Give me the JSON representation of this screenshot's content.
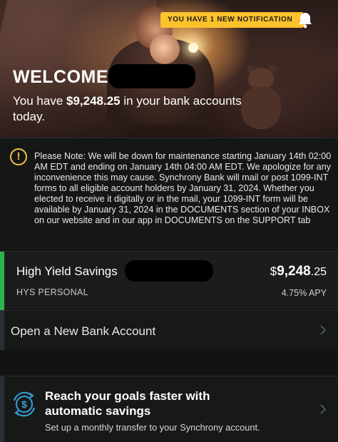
{
  "hero": {
    "notification_label": "YOU HAVE 1 NEW NOTIFICATION",
    "welcome": "WELCOME",
    "balance_prefix": "You have ",
    "balance_amount": "$9,248.25",
    "balance_suffix": " in your bank accounts today."
  },
  "notice": {
    "icon": "warning-icon",
    "text": "Please Note: We will be down for maintenance starting January 14th 02:00 AM EDT and ending on January 14th 04:00 AM EDT. We apologize for any inconvenience this may cause.  Synchrony Bank will mail or post 1099-INT forms to all eligible account holders by January 31, 2024. Whether you elected to receive it digitally or in the mail, your 1099-INT form will be available by January 31, 2024 in the DOCUMENTS section of your INBOX on our website and in our app in DOCUMENTS on the SUPPORT tab"
  },
  "account": {
    "name": "High Yield Savings",
    "type": "HYS PERSONAL",
    "balance_symbol": "$",
    "balance_whole": "9,248",
    "balance_cents": ".25",
    "apy": "4.75% APY",
    "accent_color": "#30b24b"
  },
  "open_account": {
    "label": "Open a New Bank Account"
  },
  "promo": {
    "icon": "dollar-cycle-icon",
    "title": "Reach your goals faster with automatic savings",
    "subtitle": "Set up a monthly transfer to your Synchrony account."
  },
  "colors": {
    "accent_yellow": "#fcc22b",
    "background": "#121414"
  }
}
